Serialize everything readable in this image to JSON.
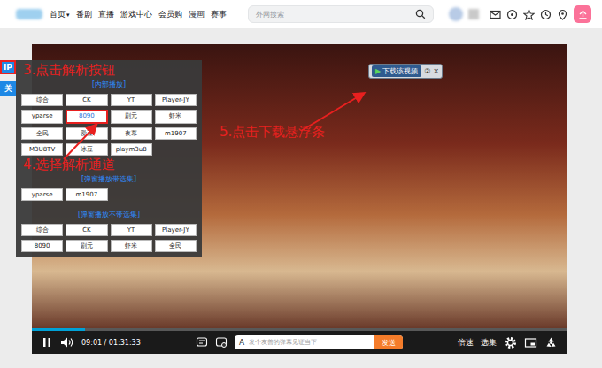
{
  "nav": {
    "items": [
      {
        "label": "首页",
        "caret": "▾"
      },
      {
        "label": "番剧"
      },
      {
        "label": "直播"
      },
      {
        "label": "游戏中心"
      },
      {
        "label": "会员购"
      },
      {
        "label": "漫画"
      },
      {
        "label": "赛事"
      }
    ],
    "search": {
      "placeholder": "外网搜索"
    }
  },
  "side_buttons": [
    {
      "label": "IP",
      "selected": true
    },
    {
      "label": "关",
      "selected": false
    }
  ],
  "annotations": [
    "3.点击解析按钮",
    "4.选择解析通道",
    "5.点击下载悬浮条"
  ],
  "panel": {
    "sections": [
      {
        "title": "[内部播放]",
        "buttons": [
          {
            "label": "综合",
            "selected": false
          },
          {
            "label": "CK",
            "selected": false
          },
          {
            "label": "YT",
            "selected": false
          },
          {
            "label": "Player-JY",
            "selected": false
          },
          {
            "label": "yparse",
            "selected": false
          },
          {
            "label": "8090",
            "selected": true
          },
          {
            "label": "剧元",
            "selected": false
          },
          {
            "label": "虾米",
            "selected": false
          },
          {
            "label": "全民",
            "selected": false
          },
          {
            "label": "爱豆",
            "selected": false
          },
          {
            "label": "夜幕",
            "selected": false
          },
          {
            "label": "m1907",
            "selected": false
          },
          {
            "label": "M3U8TV",
            "selected": false
          },
          {
            "label": "冰豆",
            "selected": false
          },
          {
            "label": "playm3u8",
            "selected": false
          }
        ]
      },
      {
        "title": "[弹窗播放带选集]",
        "buttons": [
          {
            "label": "yparse",
            "selected": false
          },
          {
            "label": "m1907",
            "selected": false
          }
        ]
      },
      {
        "title": "[弹窗播放不带选集]",
        "buttons": [
          {
            "label": "综合",
            "selected": false
          },
          {
            "label": "CK",
            "selected": false
          },
          {
            "label": "YT",
            "selected": false
          },
          {
            "label": "Player-JY",
            "selected": false
          },
          {
            "label": "8090",
            "selected": false
          },
          {
            "label": "剧元",
            "selected": false
          },
          {
            "label": "虾米",
            "selected": false
          },
          {
            "label": "全民",
            "selected": false
          }
        ]
      }
    ]
  },
  "download_bar": {
    "play": "▶",
    "label": "下载该视频",
    "badge": "②",
    "close": "×"
  },
  "player": {
    "time": "09:01 / 01:31:33",
    "progress": {
      "level": 0.1
    },
    "danmaku": {
      "prefix": "A",
      "placeholder": "发个友善的弹幕见证当下",
      "send": "发送"
    },
    "right": [
      "倍速",
      "选集"
    ]
  }
}
